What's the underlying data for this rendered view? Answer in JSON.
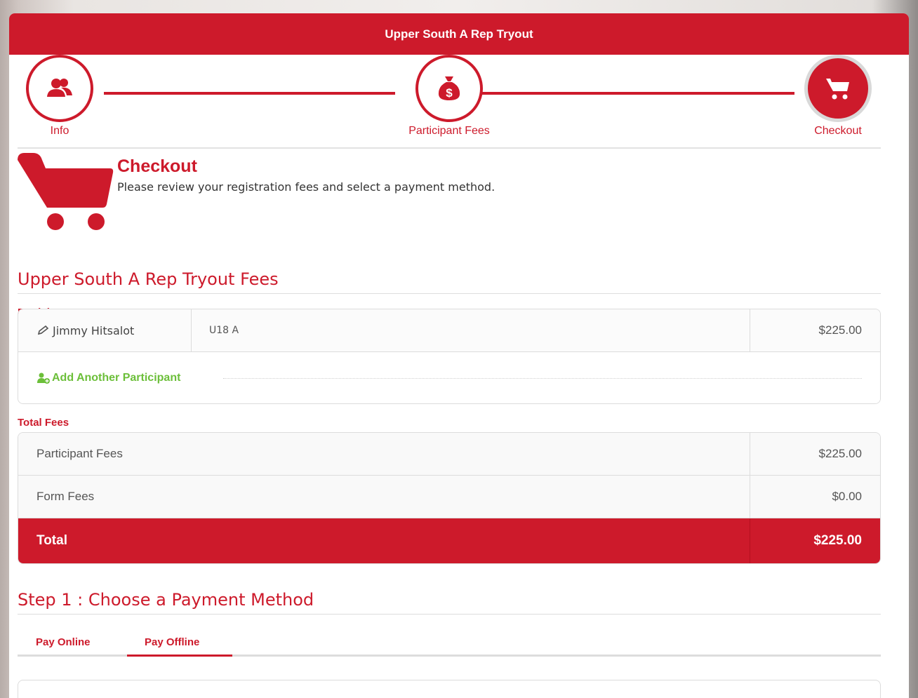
{
  "header": {
    "title": "Upper South A Rep Tryout"
  },
  "stepper": {
    "steps": [
      {
        "label": "Info",
        "icon": "users-icon"
      },
      {
        "label": "Participant Fees",
        "icon": "money-bag-icon"
      },
      {
        "label": "Checkout",
        "icon": "cart-icon"
      }
    ],
    "active_step": "Checkout"
  },
  "checkout": {
    "title": "Checkout",
    "subtitle": "Please review your registration fees and select a payment method."
  },
  "fees_section": {
    "title": "Upper South A Rep Tryout Fees",
    "participant_fees_label": "Participant Fees",
    "participants": [
      {
        "name": "Jimmy Hitsalot",
        "division": "U18 A",
        "amount": "$225.00"
      }
    ],
    "add_participant": "Add Another Participant"
  },
  "totals": {
    "label": "Total Fees",
    "rows": [
      {
        "label": "Participant Fees",
        "amount": "$225.00"
      },
      {
        "label": "Form Fees",
        "amount": "$0.00"
      }
    ],
    "total_label": "Total",
    "total_amount": "$225.00"
  },
  "payment": {
    "title": "Step 1 : Choose a Payment Method",
    "tabs": [
      {
        "label": "Pay Online"
      },
      {
        "label": "Pay Offline"
      }
    ],
    "selected_tab": "Pay Offline"
  },
  "colors": {
    "accent": "#cd1a2b",
    "success": "#6cbf3a"
  }
}
